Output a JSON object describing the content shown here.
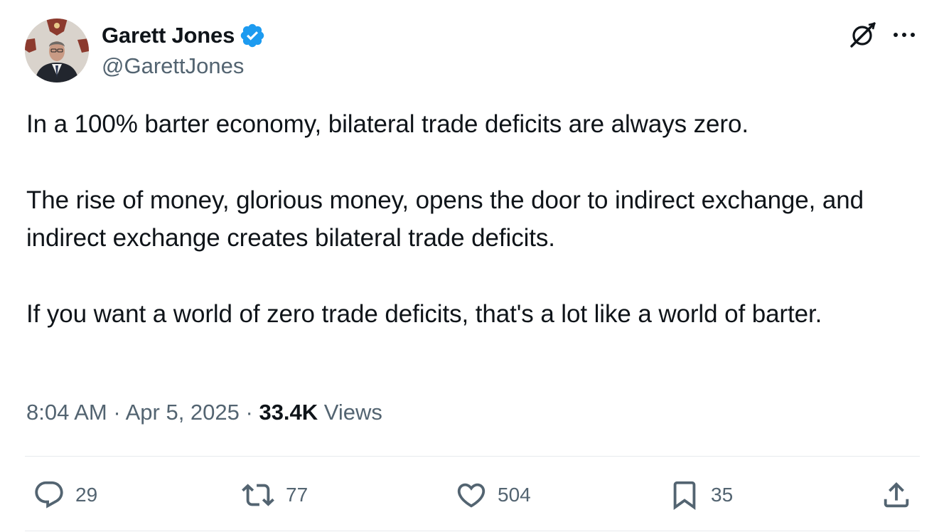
{
  "author": {
    "display_name": "Garett Jones",
    "handle": "@GarettJones",
    "verified": true,
    "verified_color": "#1d9bf0"
  },
  "tweet": {
    "paragraphs": [
      "In a 100% barter economy, bilateral trade deficits are always zero.",
      "The rise of money, glorious money, opens the door to indirect exchange, and indirect exchange creates bilateral trade deficits.",
      "If you want a world of zero trade deficits, that's a lot like a world of barter."
    ]
  },
  "meta": {
    "time": "8:04 AM",
    "separator": " · ",
    "date": "Apr 5, 2025",
    "views_count": "33.4K",
    "views_label": " Views"
  },
  "actions": {
    "replies": "29",
    "retweets": "77",
    "likes": "504",
    "bookmarks": "35"
  },
  "icons": {
    "header_right": [
      "grok-icon",
      "more-icon"
    ],
    "actions": [
      "reply-icon",
      "retweet-icon",
      "like-icon",
      "bookmark-icon",
      "share-icon"
    ]
  },
  "colors": {
    "text_primary": "#0f1419",
    "text_secondary": "#536471",
    "divider": "#e7eaed",
    "verified": "#1d9bf0"
  }
}
